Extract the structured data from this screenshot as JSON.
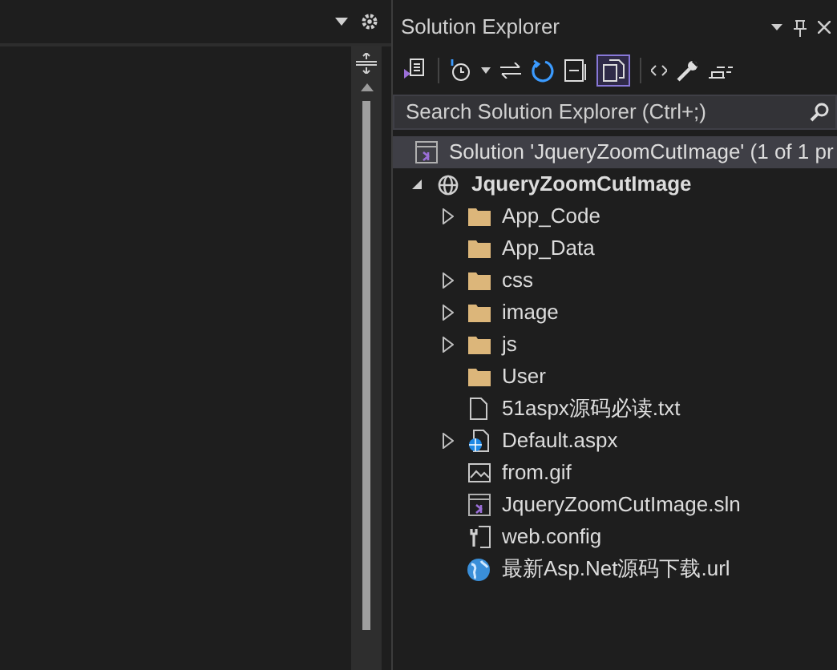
{
  "solution_explorer": {
    "title": "Solution Explorer",
    "search": {
      "placeholder": "Search Solution Explorer (Ctrl+;)"
    },
    "solution": {
      "label": "Solution 'JqueryZoomCutImage' (1 of 1 pr",
      "selected": true
    },
    "tree": [
      {
        "label": "JqueryZoomCutImage",
        "kind": "project",
        "expandable": true,
        "expanded": true,
        "children": [
          {
            "label": "App_Code",
            "kind": "folder",
            "expandable": true,
            "expanded": false
          },
          {
            "label": "App_Data",
            "kind": "folder",
            "expandable": false,
            "expanded": false
          },
          {
            "label": "css",
            "kind": "folder",
            "expandable": true,
            "expanded": false
          },
          {
            "label": "image",
            "kind": "folder",
            "expandable": true,
            "expanded": false
          },
          {
            "label": "js",
            "kind": "folder",
            "expandable": true,
            "expanded": false
          },
          {
            "label": "User",
            "kind": "folder",
            "expandable": false,
            "expanded": false
          },
          {
            "label": "51aspx源码必读.txt",
            "kind": "text-file",
            "expandable": false,
            "expanded": false
          },
          {
            "label": "Default.aspx",
            "kind": "web-page",
            "expandable": true,
            "expanded": false
          },
          {
            "label": "from.gif",
            "kind": "image",
            "expandable": false,
            "expanded": false
          },
          {
            "label": "JqueryZoomCutImage.sln",
            "kind": "solution-file",
            "expandable": false,
            "expanded": false
          },
          {
            "label": "web.config",
            "kind": "config",
            "expandable": false,
            "expanded": false
          },
          {
            "label": "最新Asp.Net源码下载.url",
            "kind": "web-link",
            "expandable": false,
            "expanded": false
          }
        ]
      }
    ]
  }
}
